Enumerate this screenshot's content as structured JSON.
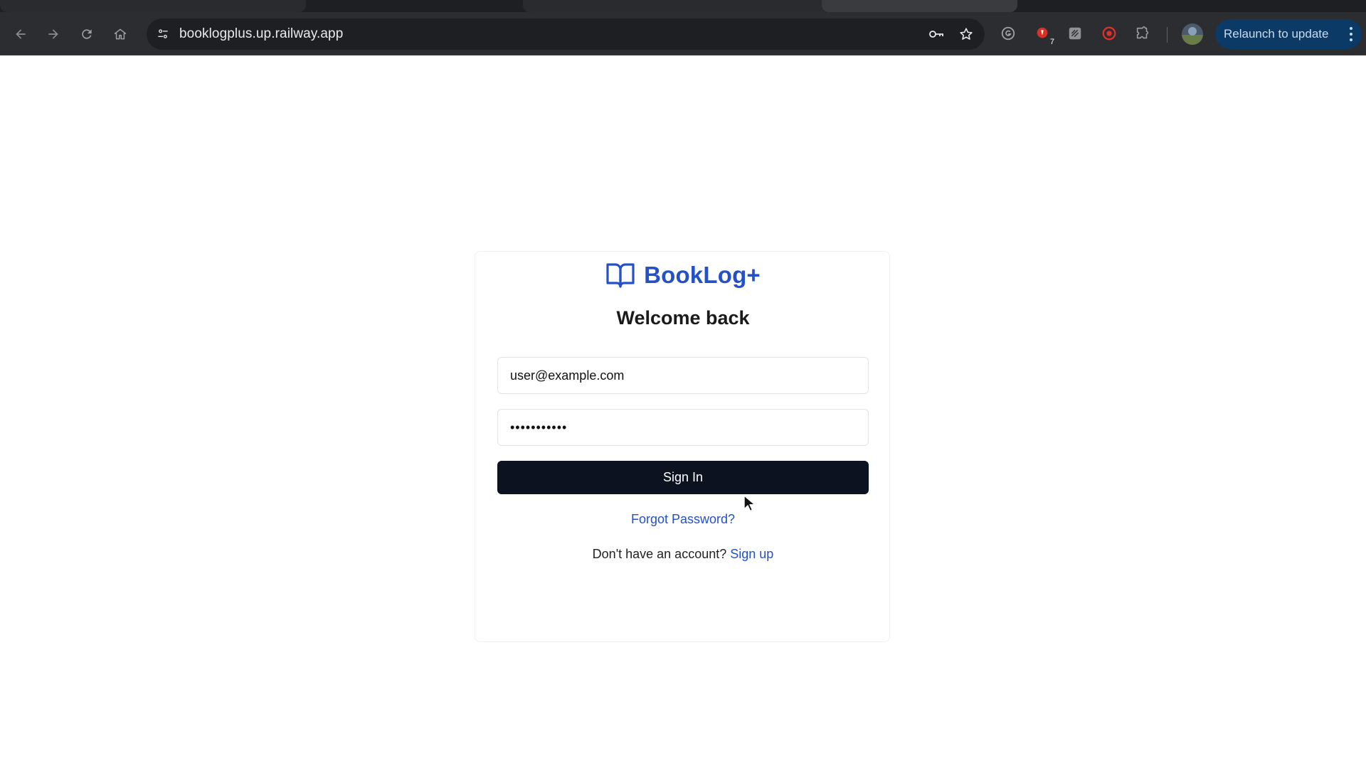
{
  "browser": {
    "url": "booklogplus.up.railway.app",
    "relaunch_label": "Relaunch to update",
    "extension_badge": "7",
    "icons": {
      "back": "arrow-left-icon",
      "forward": "arrow-right-icon",
      "reload": "reload-icon",
      "home": "home-icon",
      "site_info": "tune-icon",
      "passwords": "key-icon",
      "bookmark": "star-icon",
      "extensions": "puzzle-icon",
      "menu": "kebab-menu-icon"
    }
  },
  "login": {
    "brand": "BookLog+",
    "brand_icon": "open-book-icon",
    "heading": "Welcome back",
    "email_value": "user@example.com",
    "password_value": "•••••••••••",
    "signin_label": "Sign In",
    "forgot_label": "Forgot Password?",
    "no_account_text": "Don't have an account?",
    "signup_label": "Sign up"
  },
  "colors": {
    "accent": "#2451c8",
    "button_bg": "#0d1220",
    "toolbar_bg": "#2c2d30",
    "relaunch_bg": "#0b3a66"
  }
}
